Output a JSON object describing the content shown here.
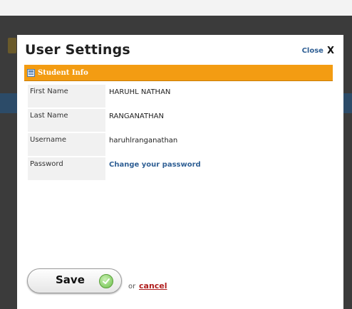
{
  "modal": {
    "title": "User Settings",
    "close_label": "Close",
    "close_glyph": "X"
  },
  "section": {
    "title": "Student Info",
    "icon": "document-icon",
    "color": "#f39c12"
  },
  "fields": [
    {
      "label": "First Name",
      "value": "HARUHL NATHAN"
    },
    {
      "label": "Last Name",
      "value": "RANGANATHAN"
    },
    {
      "label": "Username",
      "value": "haruhlranganathan"
    },
    {
      "label": "Password",
      "value": "Change your password"
    }
  ],
  "actions": {
    "save_label": "Save",
    "or_text": "or",
    "cancel_label": "cancel"
  }
}
